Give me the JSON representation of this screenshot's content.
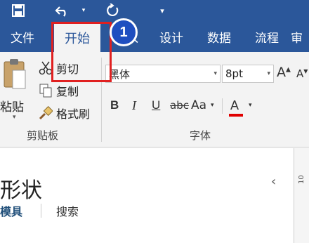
{
  "qat": {
    "save_icon": "save-icon",
    "undo_icon": "undo-icon",
    "undo_arrow": "▾",
    "redo_icon": "redo-icon",
    "customize_icon": "▾"
  },
  "tabs": [
    {
      "label": "文件"
    },
    {
      "label": "开始"
    },
    {
      "label": "插入"
    },
    {
      "label": "设计"
    },
    {
      "label": "数据"
    },
    {
      "label": "流程"
    },
    {
      "label": "审"
    }
  ],
  "clipboard": {
    "paste_label": "粘贴",
    "cut_label": "剪切",
    "copy_label": "复制",
    "format_painter_label": "格式刷",
    "group_label": "剪贴板"
  },
  "font": {
    "name": "黑体",
    "size": "8pt",
    "grow": "A",
    "shrink": "A",
    "bold": "B",
    "italic": "I",
    "underline": "U",
    "strikethrough": "abc",
    "change_case": "Aa",
    "font_color": "A",
    "group_label": "字体"
  },
  "shapes_panel": {
    "title": "形状",
    "tab_stencils": "模具",
    "tab_search": "搜索",
    "collapse": "‹",
    "ruler_label": "10"
  },
  "annotation": {
    "badge_number": "1"
  },
  "colors": {
    "ribbon_blue": "#2b579a",
    "highlight_red": "#e02020",
    "badge_blue": "#1f4fc0"
  }
}
